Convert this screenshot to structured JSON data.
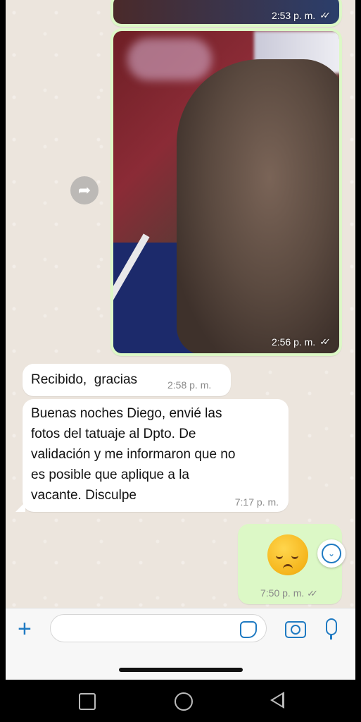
{
  "messages": [
    {
      "type": "image",
      "direction": "outgoing",
      "time": "2:53 p. m.",
      "status": "✓✓"
    },
    {
      "type": "image",
      "direction": "outgoing",
      "time": "2:56 p. m.",
      "status": "✓✓"
    },
    {
      "type": "text",
      "direction": "incoming",
      "text": "Recibido,  gracias",
      "time": "2:58 p. m."
    },
    {
      "type": "text",
      "direction": "incoming",
      "lines": [
        "Buenas noches Diego, envié las",
        "fotos del tatuaje al Dpto. De",
        "validación y me informaron que no",
        "es posible que aplique a la",
        "vacante. Disculpe"
      ],
      "time": "7:17 p. m."
    },
    {
      "type": "emoji",
      "direction": "outgoing",
      "emoji": "disappointed-face",
      "time": "7:50 p. m.",
      "status": "✓✓"
    }
  ],
  "composer": {
    "placeholder": "",
    "icons": [
      "plus-icon",
      "sticker-icon",
      "camera-icon",
      "microphone-icon"
    ]
  },
  "colors": {
    "outgoing": "#dcf8c6",
    "incoming": "#ffffff",
    "accent": "#1f7ac2",
    "background": "#ece5dd"
  }
}
